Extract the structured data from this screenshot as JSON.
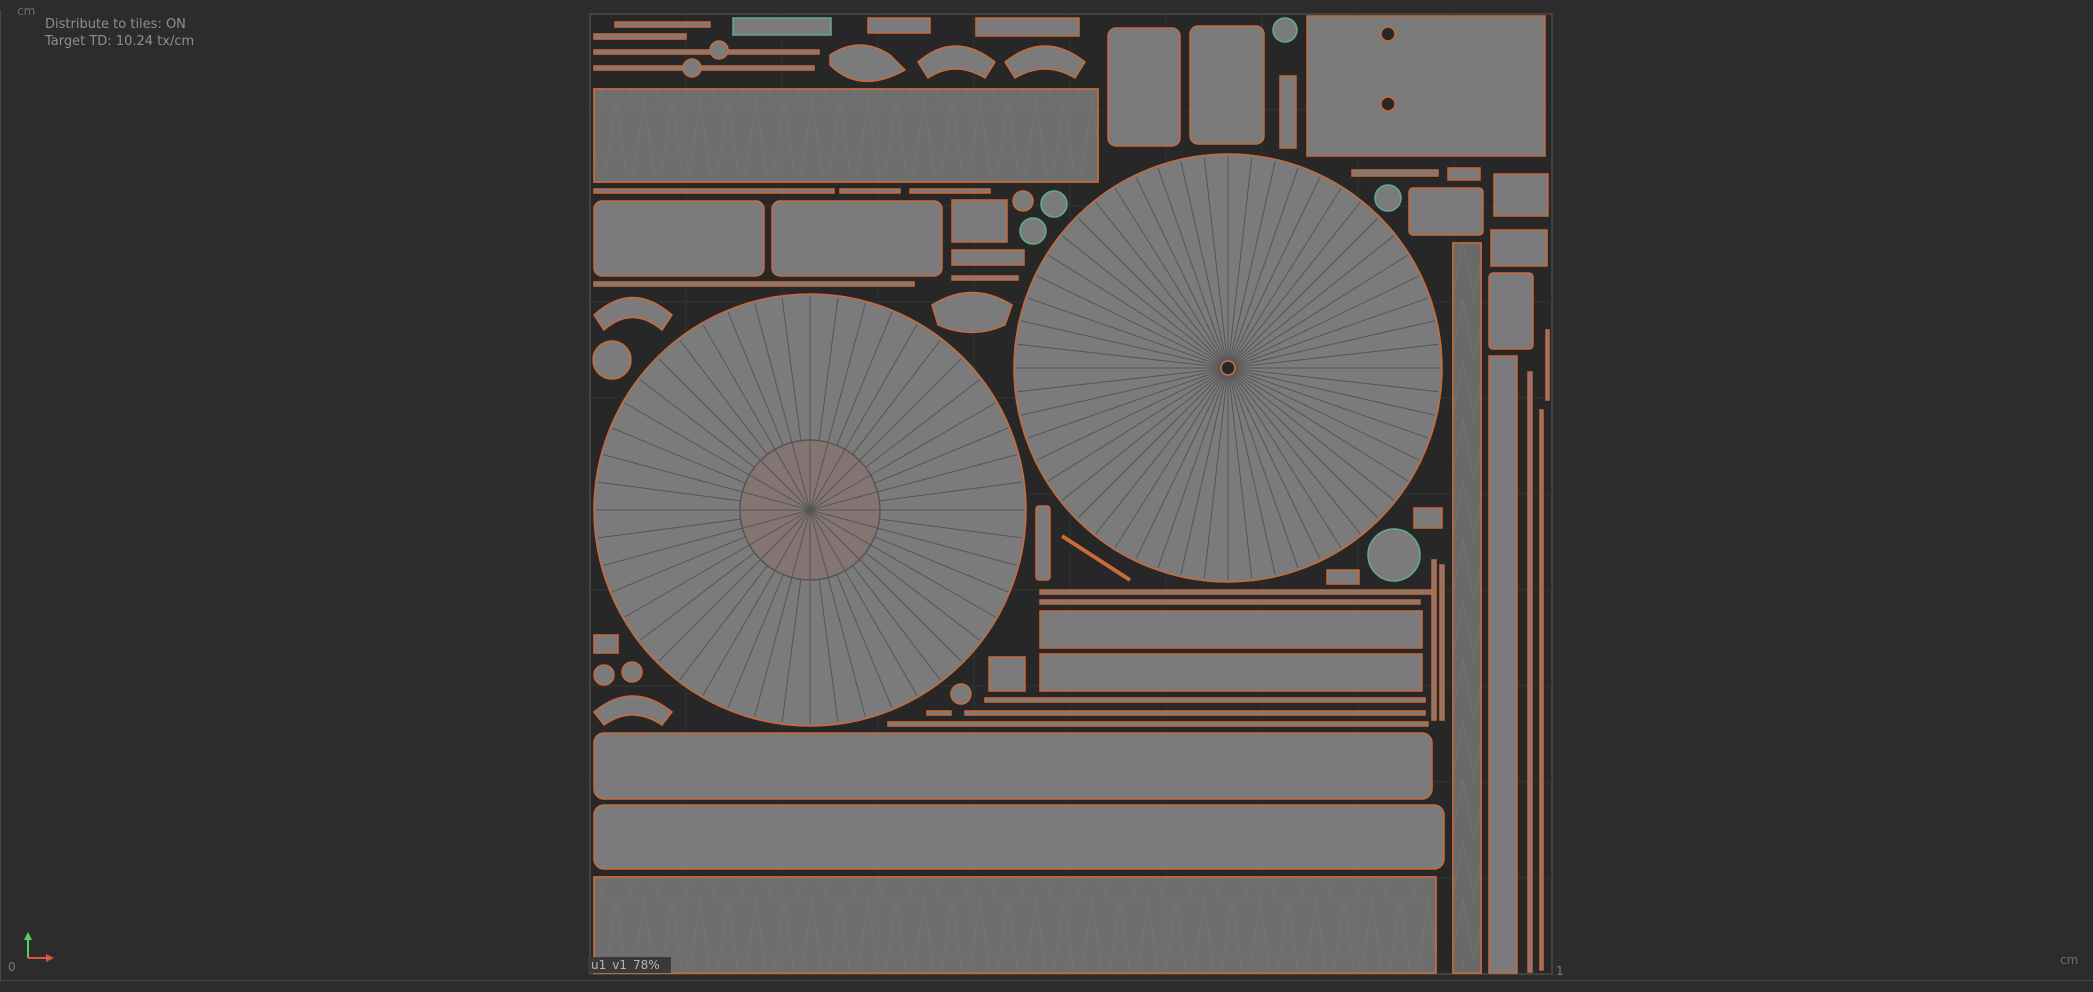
{
  "hud": {
    "distribute": "Distribute to tiles: ON",
    "target_td": "Target TD: 10.24 tx/cm"
  },
  "units": {
    "top_left": "cm",
    "bottom_right": "cm"
  },
  "axis": {
    "origin": "0",
    "tile_end": "1"
  },
  "tile": {
    "u": "u1",
    "v": "v1",
    "zoom": "78%"
  },
  "colors": {
    "background": "#2c2c2c",
    "tile_fill": "#272727",
    "shell_fill": "#7b7b7b",
    "shell_edge": "#c86a3c",
    "wire": "#3c3c3c",
    "accent_green": "#5fae8a",
    "axis_x": "#e0533c",
    "axis_y": "#4fd06a"
  },
  "icons": {
    "axis_gizmo": "uv-axis-icon"
  }
}
